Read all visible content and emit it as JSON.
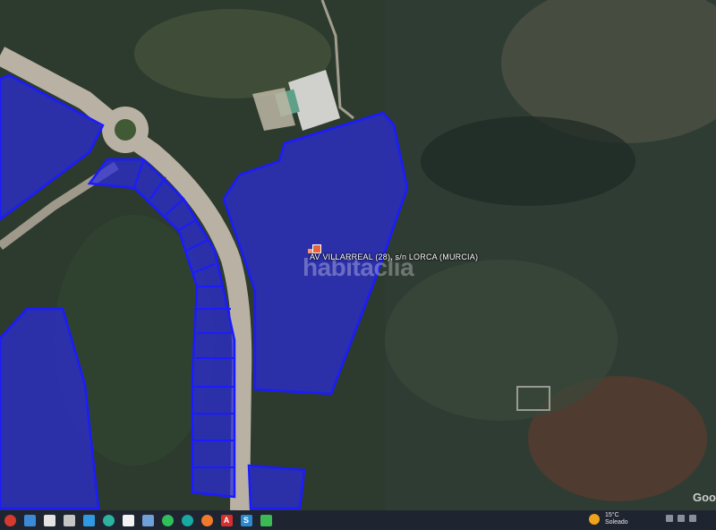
{
  "map": {
    "address_label": "AV VILLARREAL (28), s/n LORCA (MURCIA)",
    "watermark": "habitaclia",
    "attribution": "Goo",
    "parcel_color": "#2b2bd8"
  },
  "taskbar": {
    "icons": [
      "chrome-icon",
      "store-icon",
      "explorer-icon",
      "app-icon",
      "photos-icon",
      "edge-icon",
      "file-icon",
      "folder-icon",
      "whatsapp-icon",
      "teams-icon",
      "firefox-icon",
      "acrobat-icon",
      "app2-icon",
      "app3-icon"
    ],
    "weather": {
      "temperature": "15°C",
      "condition": "Soleado"
    }
  }
}
